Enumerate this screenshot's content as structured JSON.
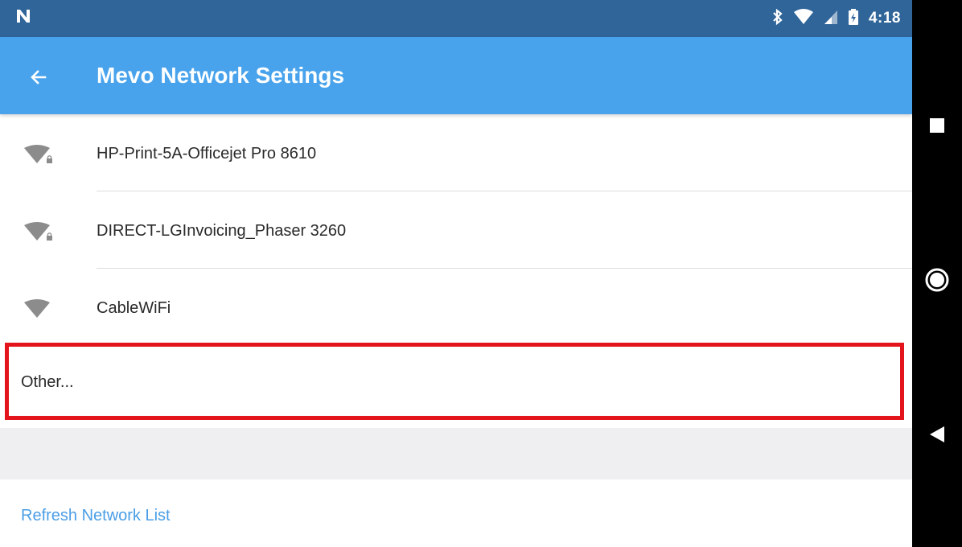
{
  "status_bar": {
    "notification_icon": "n-icon",
    "icons": [
      "bluetooth-icon",
      "wifi-signal-icon",
      "cell-signal-icon",
      "battery-icon"
    ],
    "time": "4:18"
  },
  "app_bar": {
    "back_icon": "arrow-left-icon",
    "title": "Mevo Network Settings"
  },
  "networks": [
    {
      "ssid": "HP-Print-5A-Officejet Pro 8610",
      "secured": true
    },
    {
      "ssid": "DIRECT-LGInvoicing_Phaser 3260",
      "secured": true
    },
    {
      "ssid": "CableWiFi",
      "secured": false
    }
  ],
  "other": {
    "label": "Other..."
  },
  "refresh": {
    "label": "Refresh Network List"
  },
  "nav_bar": {
    "icons": [
      "recents-square-icon",
      "home-circle-icon",
      "back-triangle-icon"
    ]
  },
  "colors": {
    "status_bar": "#30659a",
    "app_bar": "#48a3ec",
    "highlight": "#e3141b",
    "link": "#4a9ee6"
  }
}
